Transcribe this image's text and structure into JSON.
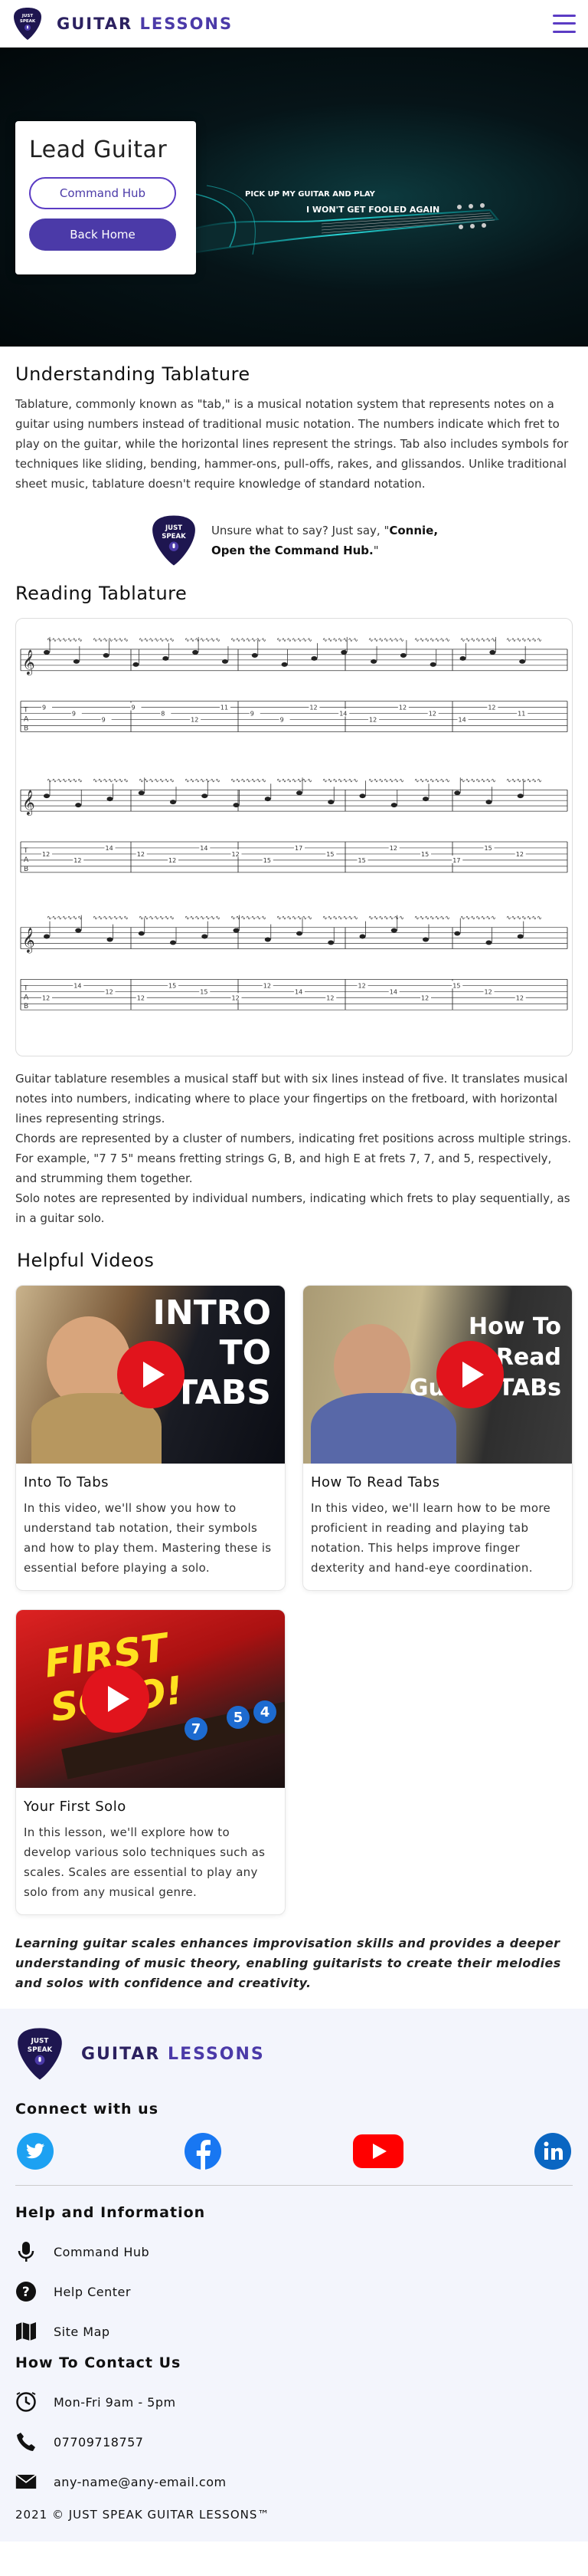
{
  "header": {
    "brand_main": "GUITAR",
    "brand_accent": "LESSONS",
    "logo_line1": "JUST",
    "logo_line2": "SPEAK"
  },
  "hero": {
    "title": "Lead Guitar",
    "command_hub_label": "Command Hub",
    "back_home_label": "Back Home",
    "guitar_text1": "PICK UP MY GUITAR AND PLAY",
    "guitar_text2": "I WON'T GET FOOLED AGAIN"
  },
  "understanding": {
    "heading": "Understanding Tablature",
    "paragraph": "Tablature, commonly known as \"tab,\" is a musical notation system that represents notes on a guitar using numbers instead of traditional music notation. The numbers indicate which fret to play on the guitar, while the horizontal lines represent the strings. Tab also includes symbols for techniques like sliding, bending, hammer-ons, pull-offs, rakes, and glissandos. Unlike traditional sheet music, tablature doesn't require knowledge of standard notation."
  },
  "tip": {
    "line1": "Unsure what to say? Just say, \"",
    "name": "Connie,",
    "line2": "Open the Command Hub.",
    "end": "\""
  },
  "reading": {
    "heading": "Reading Tablature",
    "p1": "Guitar tablature resembles a musical staff but with six lines instead of five. It translates musical notes into numbers, indicating where to place your fingertips on the fretboard, with horizontal lines representing strings.",
    "p2": "Chords are represented by a cluster of numbers, indicating fret positions across multiple strings. For example, \"7 7 5\" means fretting strings G, B, and high E at frets 7, 7, and 5, respectively, and strumming them together.",
    "p3": "Solo notes are represented by individual numbers, indicating which frets to play sequentially, as in a guitar solo."
  },
  "videos": {
    "heading": "Helpful Videos",
    "items": [
      {
        "title": "Into To Tabs",
        "description": "In this video, we'll show you how to understand tab notation, their symbols and how to play them. Mastering these is essential before playing a solo.",
        "thumb_text": "INTRO TO TABS"
      },
      {
        "title": "How To Read Tabs",
        "description": "In this video, we'll learn how to be more proficient in reading and playing tab notation. This helps improve finger dexterity and hand-eye coordination.",
        "thumb_text": "How To Read Guitar TABs"
      },
      {
        "title": "Your First Solo",
        "description": "In this lesson, we'll explore how to develop various solo techniques such as scales. Scales are essential to play any solo from any musical genre.",
        "thumb_text": "FIRST SOLO!"
      }
    ]
  },
  "closing": "Learning guitar scales enhances improvisation skills and provides a deeper understanding of music theory, enabling guitarists to create their melodies and solos with confidence and creativity.",
  "footer": {
    "connect_heading": "Connect with us",
    "help_heading": "Help and Information",
    "help_items": [
      "Command Hub",
      "Help Center",
      "Site Map"
    ],
    "contact_heading": "How To Contact Us",
    "contact_items": [
      "Mon-Fri 9am - 5pm",
      "07709718757",
      "any-name@any-email.com"
    ],
    "copyright": "2021 © JUST SPEAK GUITAR LESSONS™"
  },
  "colors": {
    "brand": "#4b3aa8",
    "brand_dark": "#2c2160",
    "play_red": "#e1141c",
    "footer_bg": "#f3f5fc"
  }
}
